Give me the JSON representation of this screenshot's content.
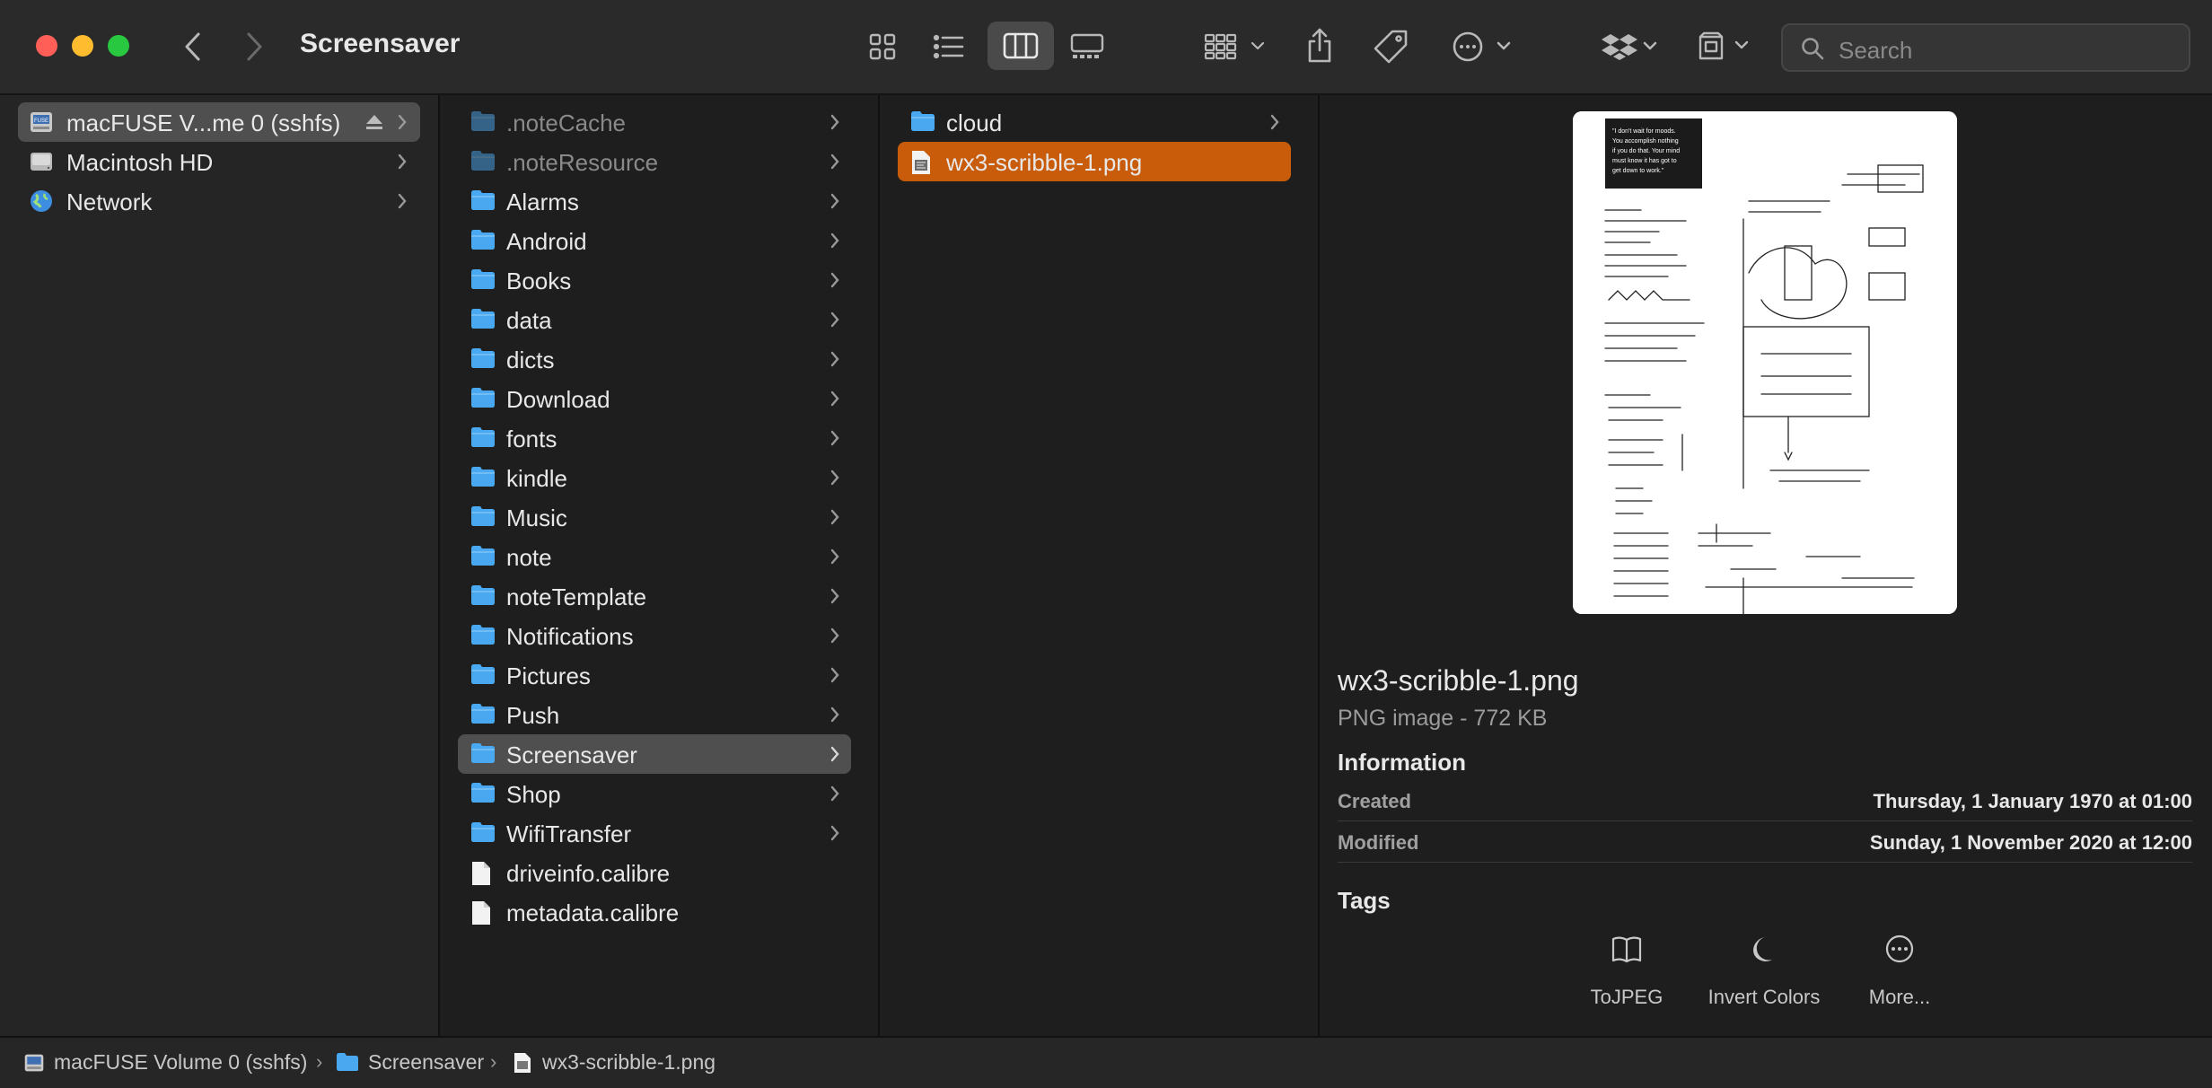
{
  "window": {
    "title": "Screensaver"
  },
  "toolbar": {
    "back_icon": "chevron-left-icon",
    "forward_icon": "chevron-right-icon",
    "view_modes": [
      "icons",
      "list",
      "columns",
      "gallery"
    ],
    "active_view": "columns",
    "search_placeholder": "Search"
  },
  "sidebar": {
    "items": [
      {
        "label": "macFUSE V...me 0 (sshfs)",
        "icon": "fuse-drive-icon",
        "selected": true,
        "eject": true
      },
      {
        "label": "Macintosh HD",
        "icon": "hard-drive-icon",
        "selected": false
      },
      {
        "label": "Network",
        "icon": "network-globe-icon",
        "selected": false
      }
    ]
  },
  "column1": {
    "items": [
      {
        "label": ".noteCache",
        "type": "folder",
        "dim": true
      },
      {
        "label": ".noteResource",
        "type": "folder",
        "dim": true
      },
      {
        "label": "Alarms",
        "type": "folder"
      },
      {
        "label": "Android",
        "type": "folder"
      },
      {
        "label": "Books",
        "type": "folder"
      },
      {
        "label": "data",
        "type": "folder"
      },
      {
        "label": "dicts",
        "type": "folder"
      },
      {
        "label": "Download",
        "type": "folder"
      },
      {
        "label": "fonts",
        "type": "folder"
      },
      {
        "label": "kindle",
        "type": "folder"
      },
      {
        "label": "Music",
        "type": "folder"
      },
      {
        "label": "note",
        "type": "folder"
      },
      {
        "label": "noteTemplate",
        "type": "folder"
      },
      {
        "label": "Notifications",
        "type": "folder"
      },
      {
        "label": "Pictures",
        "type": "folder"
      },
      {
        "label": "Push",
        "type": "folder"
      },
      {
        "label": "Screensaver",
        "type": "folder",
        "selected": true
      },
      {
        "label": "Shop",
        "type": "folder"
      },
      {
        "label": "WifiTransfer",
        "type": "folder"
      },
      {
        "label": "driveinfo.calibre",
        "type": "file"
      },
      {
        "label": "metadata.calibre",
        "type": "file"
      }
    ]
  },
  "column2": {
    "items": [
      {
        "label": "cloud",
        "type": "folder"
      },
      {
        "label": "wx3-scribble-1.png",
        "type": "image",
        "selected": true
      }
    ]
  },
  "preview": {
    "image_quote": "\"I don't wait for moods. You accomplish nothing if you do that. Your mind must know it has got to get down to work.\"",
    "name": "wx3-scribble-1.png",
    "kind": "PNG image - 772 KB",
    "info_heading": "Information",
    "info": [
      {
        "key": "Created",
        "value": "Thursday, 1 January 1970 at 01:00"
      },
      {
        "key": "Modified",
        "value": "Sunday, 1 November 2020 at 12:00"
      }
    ],
    "tags_heading": "Tags",
    "actions": [
      {
        "label": "ToJPEG",
        "icon": "book-icon"
      },
      {
        "label": "Invert Colors",
        "icon": "moon-icon"
      },
      {
        "label": "More...",
        "icon": "ellipsis-circle-icon"
      }
    ]
  },
  "pathbar": {
    "crumbs": [
      {
        "label": "macFUSE Volume 0 (sshfs)",
        "icon": "fuse-drive-icon"
      },
      {
        "label": "Screensaver",
        "icon": "folder-icon"
      },
      {
        "label": "wx3-scribble-1.png",
        "icon": "image-file-icon"
      }
    ],
    "separator": "›"
  },
  "colors": {
    "selection_orange": "#c85c0a",
    "selection_gray": "#4f4f4f",
    "folder_blue": "#4aa8f0"
  }
}
